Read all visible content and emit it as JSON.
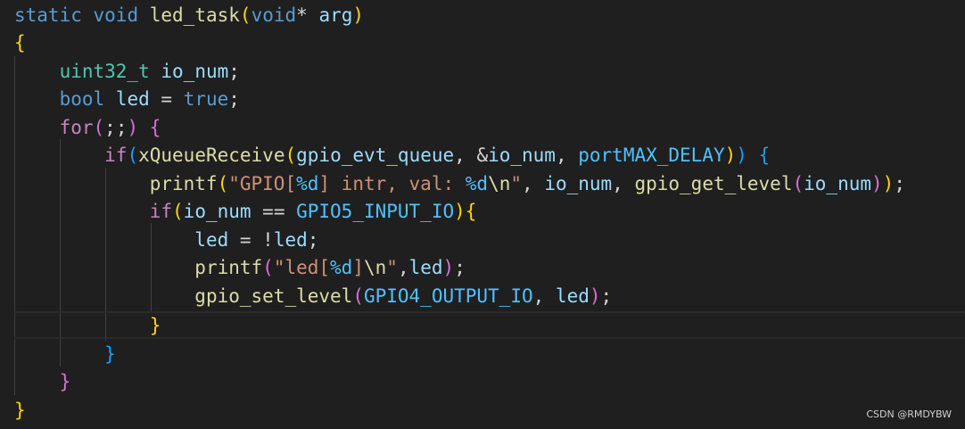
{
  "code": {
    "l1": {
      "static": "static",
      "void": "void",
      "fname": "led_task",
      "paren_open": "(",
      "void2": "void",
      "ptr": "*",
      "arg": "arg",
      "paren_close": ")"
    },
    "l2": {
      "brace": "{"
    },
    "l3": {
      "type": "uint32_t",
      "var": "io_num",
      "semi": ";"
    },
    "l4": {
      "type": "bool",
      "var": "led",
      "eq": " = ",
      "val": "true",
      "semi": ";"
    },
    "l5": {
      "kw": "for",
      "open": "(",
      "mid": ";;",
      "close": ")",
      "brace": "{"
    },
    "l6": {
      "kw": "if",
      "open": "(",
      "fn": "xQueueReceive",
      "open2": "(",
      "a1": "gpio_evt_queue",
      "c1": ", &",
      "a2": "io_num",
      "c2": ", ",
      "a3": "portMAX_DELAY",
      "close2": ")",
      "close": ")",
      "brace": "{"
    },
    "l7": {
      "fn": "printf",
      "open": "(",
      "s1": "\"GPIO[",
      "fmt1": "%d",
      "s2": "] intr, val: ",
      "fmt2": "%d",
      "esc": "\\n",
      "s3": "\"",
      "c1": ", ",
      "a1": "io_num",
      "c2": ", ",
      "fn2": "gpio_get_level",
      "open2": "(",
      "a2": "io_num",
      "close2": ")",
      "close": ")",
      "semi": ";"
    },
    "l8": {
      "kw": "if",
      "open": "(",
      "a1": "io_num",
      "op": " == ",
      "a2": "GPIO5_INPUT_IO",
      "close": ")",
      "brace": "{"
    },
    "l9": {
      "a1": "led",
      "op": " = !",
      "a2": "led",
      "semi": ";"
    },
    "l10": {
      "fn": "printf",
      "open": "(",
      "s1": "\"led[",
      "fmt": "%d",
      "s2": "]",
      "esc": "\\n",
      "s3": "\"",
      "comma": ",",
      "a1": "led",
      "close": ")",
      "semi": ";"
    },
    "l11": {
      "fn": "gpio_set_level",
      "open": "(",
      "a1": "GPIO4_OUTPUT_IO",
      "comma": ", ",
      "a2": "led",
      "close": ")",
      "semi": ";"
    },
    "l12": {
      "brace": "}"
    },
    "l13": {
      "brace": "}"
    },
    "l14": {
      "brace": "}"
    },
    "l15": {
      "brace": "}"
    }
  },
  "watermark": "CSDN @RMDYBW",
  "colors": {
    "background": "#1f1f1f",
    "keyword": "#569cd6",
    "type": "#4ec9b0",
    "control": "#c586c0",
    "function": "#dcdcaa",
    "variable": "#9cdcfe",
    "string": "#ce9178",
    "constant": "#4fc1ff",
    "bracket1": "#ffd700",
    "bracket2": "#da70d6",
    "bracket3": "#179fff"
  }
}
